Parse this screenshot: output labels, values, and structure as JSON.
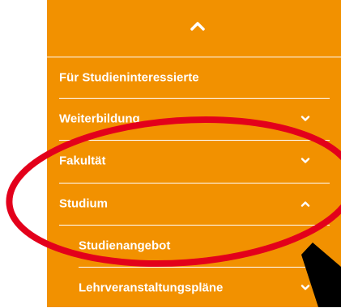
{
  "menu": {
    "background": "#f29100",
    "collapse_icon": "chevron-up-icon",
    "items": [
      {
        "label": "Für Studieninteressierte",
        "icon": null
      },
      {
        "label": "Weiterbildung",
        "icon": "chevron-down-icon"
      },
      {
        "label": "Fakultät",
        "icon": "chevron-down-icon"
      },
      {
        "label": "Studium",
        "icon": "chevron-up-icon",
        "expanded": true
      },
      {
        "label": "Studienangebot",
        "icon": null,
        "sub": true
      },
      {
        "label": "Lehrveranstaltungspläne",
        "icon": "chevron-down-icon"
      }
    ]
  },
  "annotation": {
    "ellipse_color": "#e3001b",
    "arrow_color": "#000000"
  }
}
